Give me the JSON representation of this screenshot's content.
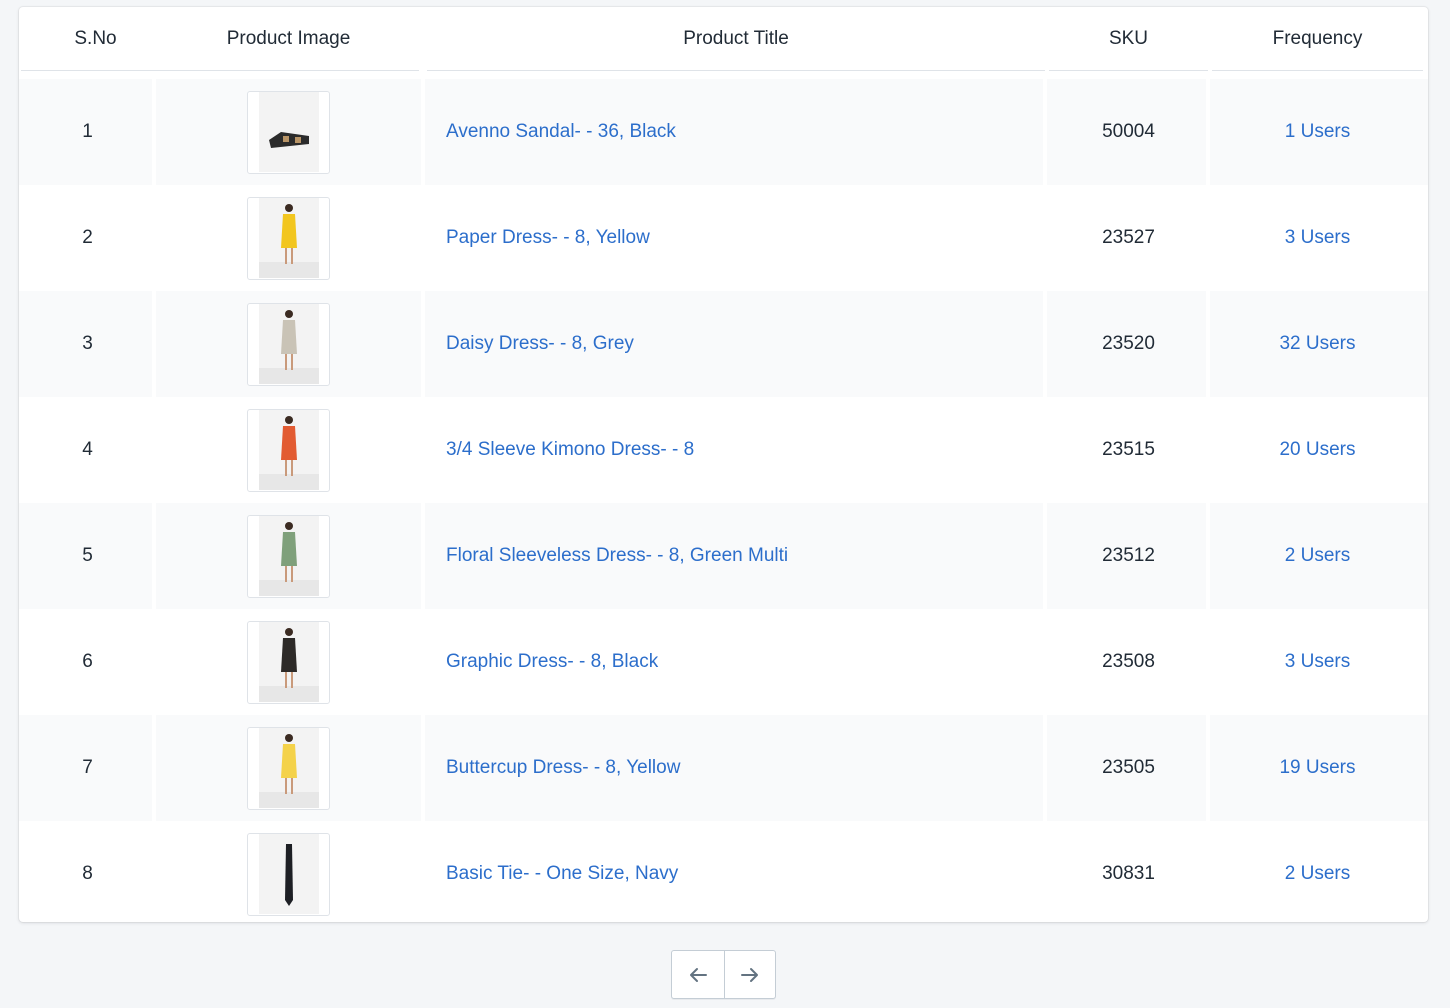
{
  "table": {
    "headers": {
      "sno": "S.No",
      "image": "Product Image",
      "title": "Product Title",
      "sku": "SKU",
      "frequency": "Frequency"
    },
    "rows": [
      {
        "sno": "1",
        "title": "Avenno Sandal- - 36, Black",
        "sku": "50004",
        "frequency": "1 Users",
        "image_icon": "sandal-thumbnail"
      },
      {
        "sno": "2",
        "title": "Paper Dress- - 8, Yellow",
        "sku": "23527",
        "frequency": "3 Users",
        "image_icon": "dress-thumbnail"
      },
      {
        "sno": "3",
        "title": "Daisy Dress- - 8, Grey",
        "sku": "23520",
        "frequency": "32 Users",
        "image_icon": "dress-thumbnail"
      },
      {
        "sno": "4",
        "title": "3/4 Sleeve Kimono Dress- - 8",
        "sku": "23515",
        "frequency": "20 Users",
        "image_icon": "dress-thumbnail"
      },
      {
        "sno": "5",
        "title": "Floral Sleeveless Dress- - 8, Green Multi",
        "sku": "23512",
        "frequency": "2 Users",
        "image_icon": "dress-thumbnail"
      },
      {
        "sno": "6",
        "title": "Graphic Dress- - 8, Black",
        "sku": "23508",
        "frequency": "3 Users",
        "image_icon": "dress-thumbnail"
      },
      {
        "sno": "7",
        "title": "Buttercup Dress- - 8, Yellow",
        "sku": "23505",
        "frequency": "19 Users",
        "image_icon": "dress-thumbnail"
      },
      {
        "sno": "8",
        "title": "Basic Tie- - One Size, Navy",
        "sku": "30831",
        "frequency": "2 Users",
        "image_icon": "tie-thumbnail"
      }
    ]
  },
  "pagination": {
    "prev_icon": "arrow-left-icon",
    "next_icon": "arrow-right-icon"
  },
  "colors": {
    "link": "#2c6ecb",
    "row_alt": "#f9fafb",
    "background": "#f4f6f8",
    "dress_colors": [
      "#f2c61f",
      "#c9c3b6",
      "#e25b32",
      "#7fa07b",
      "#2d2a28",
      "#f4d24a"
    ]
  }
}
